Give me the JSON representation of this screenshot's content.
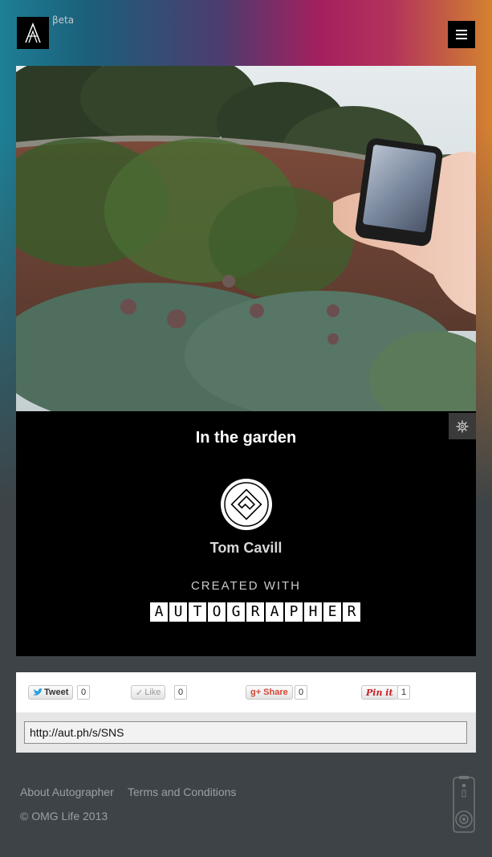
{
  "header": {
    "beta_label": "βeta",
    "logo_icon": "autographer-a-logo-icon",
    "menu_icon": "hamburger-menu-icon"
  },
  "photo": {
    "alt": "In the garden"
  },
  "card": {
    "title": "In the garden",
    "author": "Tom Cavill",
    "created_with": "CREATED WITH",
    "brand_letters": [
      "A",
      "U",
      "T",
      "O",
      "G",
      "R",
      "A",
      "P",
      "H",
      "E",
      "R"
    ],
    "settings_icon": "gear-icon"
  },
  "share": {
    "tweet_label": "Tweet",
    "tweet_count": "0",
    "like_label": "Like",
    "like_count": "0",
    "gplus_label": "Share",
    "gplus_count": "0",
    "pinit_label": "Pin it",
    "pinit_count": "1"
  },
  "url": {
    "value": "http://aut.ph/s/SNS"
  },
  "footer": {
    "about": "About Autographer",
    "terms": "Terms and Conditions",
    "copyright": "© OMG Life 2013"
  },
  "colors": {
    "background": "#3d4346",
    "card": "#000000",
    "accent_magenta": "#a41f5f",
    "accent_teal": "#1e7f95",
    "accent_orange": "#d3822f"
  }
}
